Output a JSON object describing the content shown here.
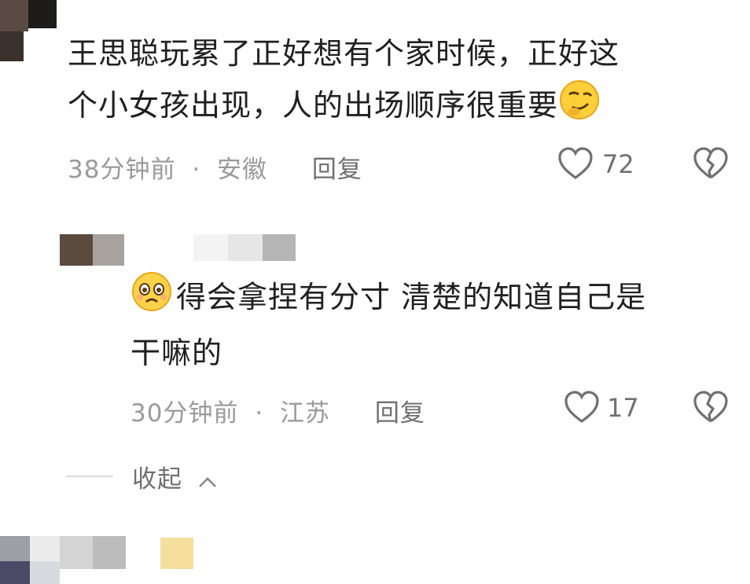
{
  "comment1": {
    "line1": "王思聪玩累了正好想有个家时候，正好这",
    "line2": "个小女孩出现，人的出场顺序很重要",
    "emoji": "smirk-emoji",
    "time": "38分钟前",
    "separator": "·",
    "location": "安徽",
    "reply_label": "回复",
    "like_count": "72"
  },
  "reply1": {
    "emoji": "pleading-emoji",
    "line1": "得会拿捏有分寸  清楚的知道自己是",
    "line2": "干嘛的",
    "time": "30分钟前",
    "separator": "·",
    "location": "江苏",
    "reply_label": "回复",
    "like_count": "17"
  },
  "collapse": {
    "label": "收起",
    "icon": "chevron-up-icon"
  },
  "colors": {
    "text": "#202020",
    "meta": "#9a9a9a",
    "icon": "#707070"
  }
}
